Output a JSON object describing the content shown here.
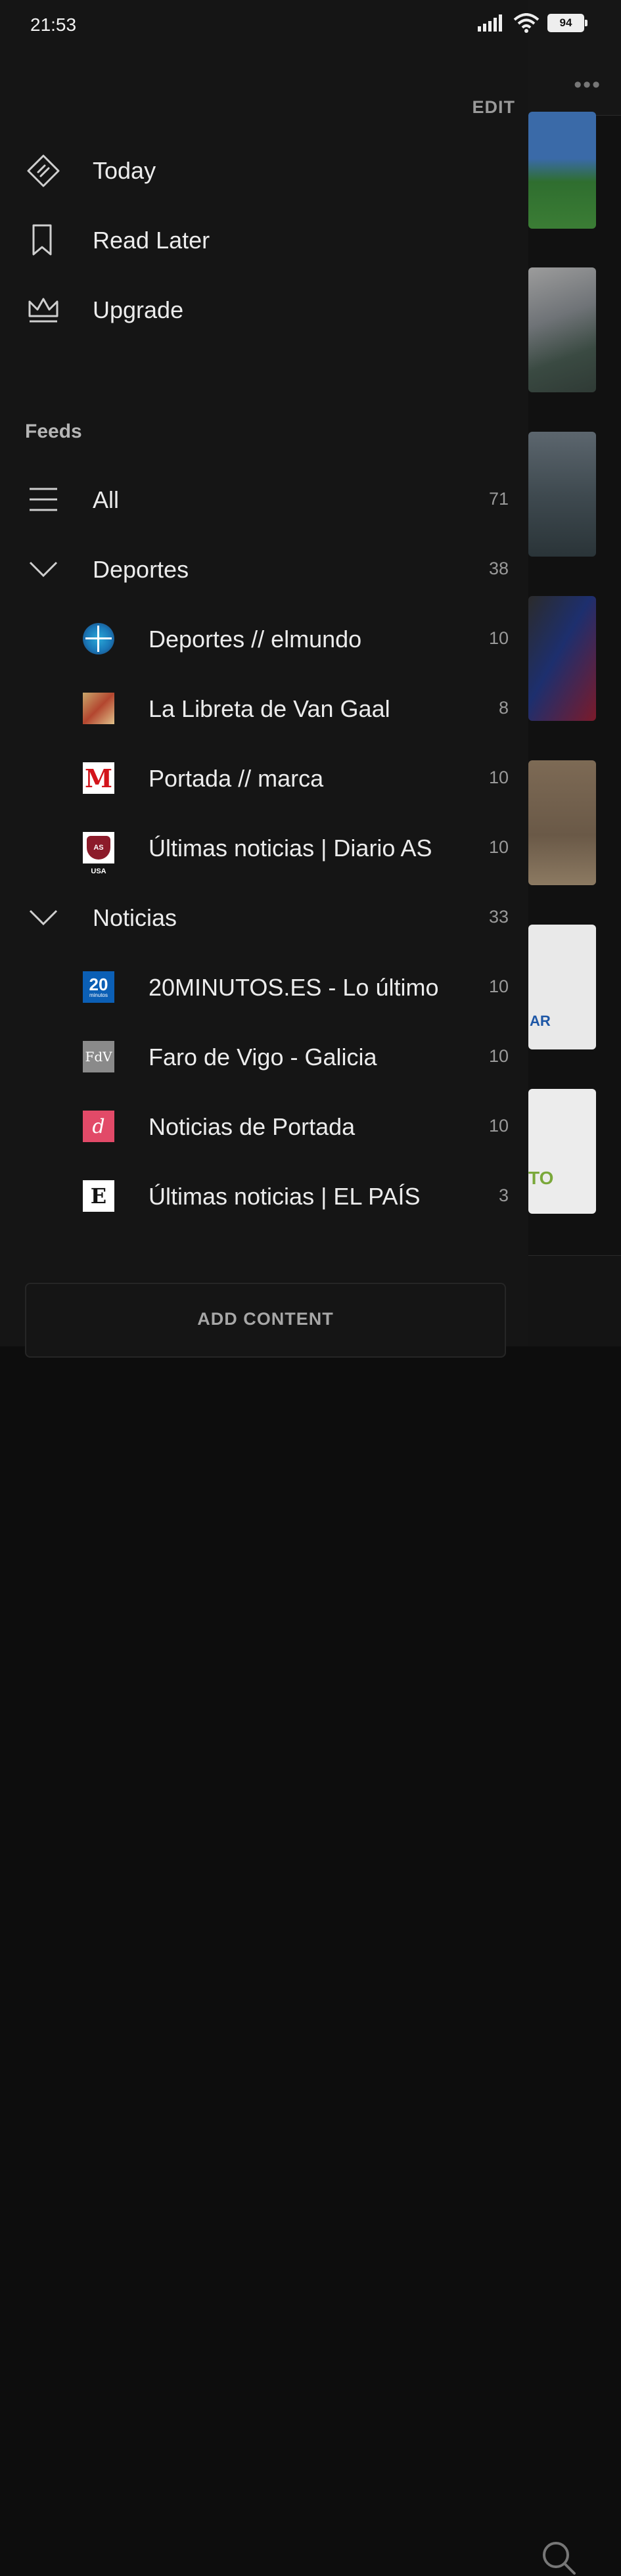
{
  "status": {
    "time": "21:53",
    "battery": "94"
  },
  "drawer": {
    "edit_label": "EDIT",
    "nav": [
      {
        "label": "Today",
        "icon": "feedly-diamond-icon"
      },
      {
        "label": "Read Later",
        "icon": "bookmark-icon"
      },
      {
        "label": "Upgrade",
        "icon": "crown-icon"
      }
    ],
    "feeds_header": "Feeds",
    "all": {
      "label": "All",
      "count": "71"
    },
    "groups": [
      {
        "label": "Deportes",
        "count": "38",
        "items": [
          {
            "label": "Deportes // elmundo",
            "count": "10"
          },
          {
            "label": "La Libreta de Van Gaal",
            "count": "8"
          },
          {
            "label": "Portada // marca",
            "count": "10"
          },
          {
            "label": "Últimas noticias | Diario AS",
            "count": "10"
          }
        ]
      },
      {
        "label": "Noticias",
        "count": "33",
        "items": [
          {
            "label": "20MINUTOS.ES - Lo último",
            "count": "10"
          },
          {
            "label": "Faro de Vigo - Galicia",
            "count": "10"
          },
          {
            "label": "Noticias de Portada",
            "count": "10"
          },
          {
            "label": "Últimas noticias | EL PAÍS",
            "count": "3"
          }
        ]
      }
    ],
    "add_content_label": "ADD CONTENT"
  },
  "favicons": {
    "marca": "M",
    "as": "AS USA",
    "twenty_min": "20",
    "twenty_min_sub": "minutos",
    "fdv": "FdV",
    "np": "d",
    "elpais": "E"
  },
  "background": {
    "thumb_ar": "AR",
    "thumb_to": "TO"
  }
}
